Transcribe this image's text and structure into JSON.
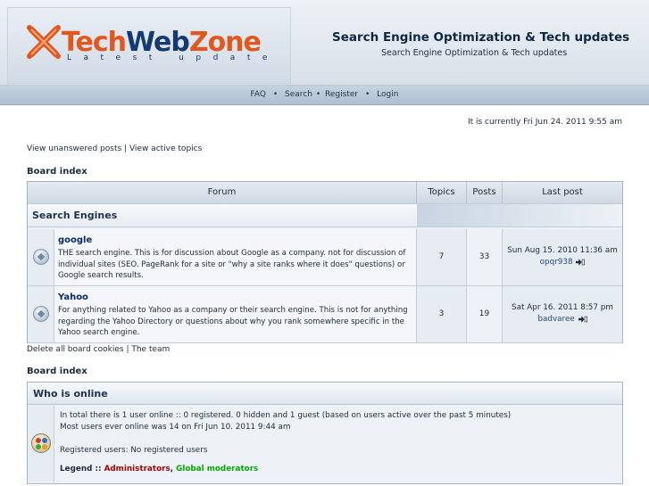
{
  "header": {
    "logo": {
      "word1": "Tech",
      "word2": "Web",
      "word3": "Zone",
      "tagline": "Latest update"
    },
    "site_title": "Search Engine Optimization & Tech updates",
    "site_description": "Search Engine Optimization & Tech updates"
  },
  "navbar": {
    "faq": "FAQ",
    "search": "Search",
    "register": "Register",
    "login": "Login",
    "separator": "•"
  },
  "timestamp": "It is currently Fri Jun 24. 2011 9:55 am",
  "top_links": {
    "unanswered": "View unanswered posts",
    "divider": "|",
    "active": "View active topics"
  },
  "board_index_label": "Board index",
  "forum_table": {
    "headers": {
      "forum": "Forum",
      "topics": "Topics",
      "posts": "Posts",
      "last_post": "Last post"
    },
    "category": "Search Engines",
    "forums": [
      {
        "name": "google",
        "description": "THE search engine. This is for discussion about Google as a company. not for discussion of individual sites (SEO. PageRank for a site or \"why a site ranks where it does\" questions) or Google search results.",
        "topics": "7",
        "posts": "33",
        "last_post_date": "Sun Aug 15. 2010 11:36 am",
        "last_post_user": "opqr938"
      },
      {
        "name": "Yahoo",
        "description": "For anything related to Yahoo as a company or their search engine. This is not for anything regarding the Yahoo Directory or questions about why you rank somewhere specific in the Yahoo search engine.",
        "topics": "3",
        "posts": "19",
        "last_post_date": "Sat Apr 16. 2011 8:57 pm",
        "last_post_user": "badvaree"
      }
    ]
  },
  "bottom_links": {
    "delete_cookies": "Delete all board cookies",
    "divider": "|",
    "team": "The team"
  },
  "who_is_online": {
    "title": "Who is online",
    "line1": "In total there is 1 user online :: 0 registered. 0 hidden and 1 guest (based on users active over the past 5 minutes)",
    "line2": "Most users ever online was 14 on Fri Jun 10. 2011 9:44 am",
    "registered": "Registered users: No registered users",
    "legend_label": "Legend ::",
    "legend_admins": "Administrators",
    "legend_comma": ",",
    "legend_mods": "Global moderators"
  },
  "colors": {
    "accent_orange": "#e3571c",
    "brand_navy": "#143a73",
    "admin_red": "#aa0000",
    "moderator_green": "#00aa00"
  },
  "icons": [
    "logo-x-icon",
    "forum-read-icon",
    "last-post-arrow-icon",
    "who-is-online-icon"
  ]
}
